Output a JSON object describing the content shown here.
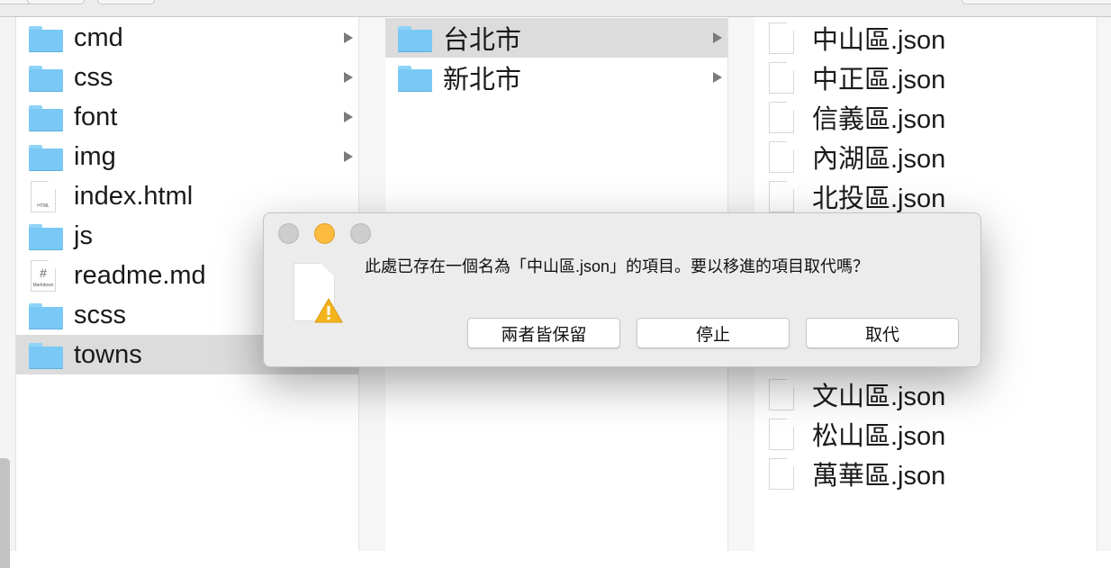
{
  "columns": [
    {
      "items": [
        {
          "name": "cmd",
          "type": "folder",
          "expandable": true
        },
        {
          "name": "css",
          "type": "folder",
          "expandable": true
        },
        {
          "name": "font",
          "type": "folder",
          "expandable": true
        },
        {
          "name": "img",
          "type": "folder",
          "expandable": true
        },
        {
          "name": "index.html",
          "type": "file",
          "tag": "HTML"
        },
        {
          "name": "js",
          "type": "folder",
          "expandable": true
        },
        {
          "name": "readme.md",
          "type": "markdown",
          "tag": "Markdown",
          "glyph": "#"
        },
        {
          "name": "scss",
          "type": "folder",
          "expandable": true
        },
        {
          "name": "towns",
          "type": "folder",
          "expandable": true,
          "selected": true
        }
      ]
    },
    {
      "items": [
        {
          "name": "台北市",
          "type": "folder",
          "expandable": true,
          "selected": true
        },
        {
          "name": "新北市",
          "type": "folder",
          "expandable": true
        }
      ]
    },
    {
      "items": [
        {
          "name": "中山區.json",
          "type": "file",
          "slot": 0
        },
        {
          "name": "中正區.json",
          "type": "file",
          "slot": 1
        },
        {
          "name": "信義區.json",
          "type": "file",
          "slot": 2
        },
        {
          "name": "內湖區.json",
          "type": "file",
          "slot": 3
        },
        {
          "name": "北投區.json",
          "type": "file",
          "slot": 4
        },
        {
          "name": "文山區.json",
          "type": "file",
          "slot": 9
        },
        {
          "name": "松山區.json",
          "type": "file",
          "slot": 10
        },
        {
          "name": "萬華區.json",
          "type": "file",
          "slot": 11
        }
      ]
    }
  ],
  "dialog": {
    "message": "此處已存在一個名為「中山區.json」的項目。要以移進的項目取代嗎？",
    "icon": "document-warning-icon",
    "buttons": {
      "keep_both": "兩者皆保留",
      "stop": "停止",
      "replace": "取代"
    },
    "traffic_lights": {
      "close": "#cdcdcd",
      "minimize": "#fdbc40",
      "zoom": "#cdcdcd"
    }
  }
}
